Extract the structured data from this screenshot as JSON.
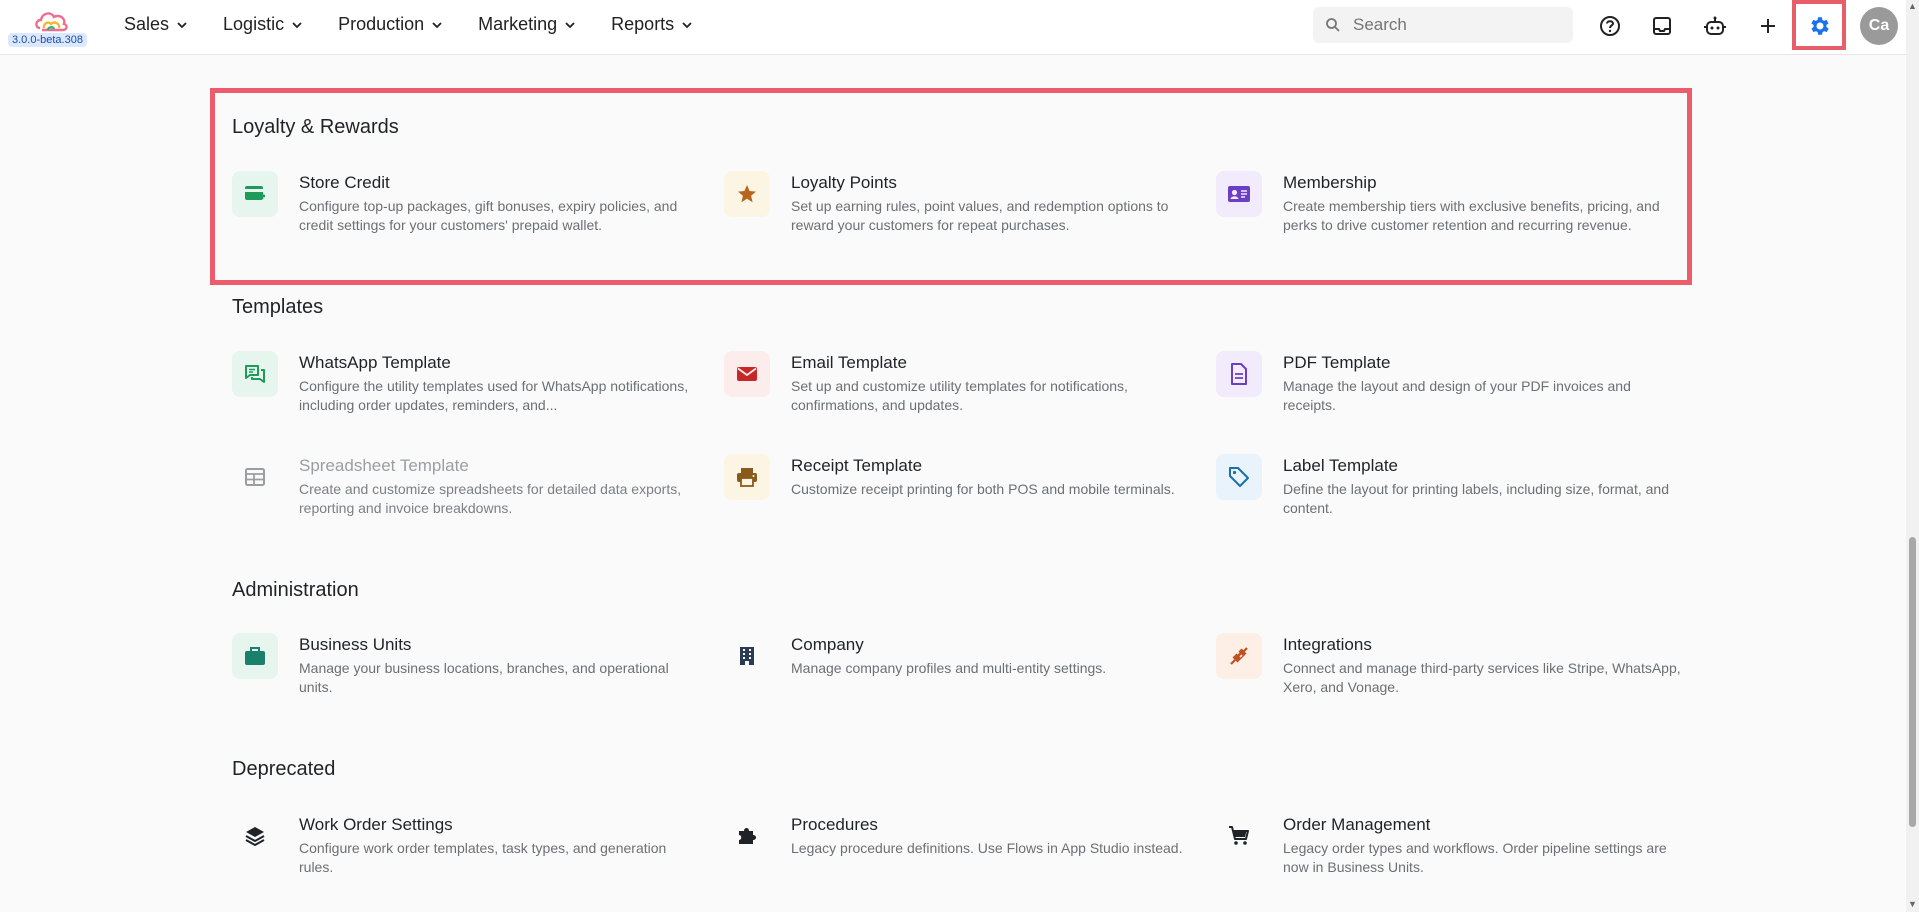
{
  "app": {
    "version": "3.0.0-beta.308"
  },
  "nav": [
    {
      "label": "Sales"
    },
    {
      "label": "Logistic"
    },
    {
      "label": "Production"
    },
    {
      "label": "Marketing"
    },
    {
      "label": "Reports"
    }
  ],
  "search": {
    "placeholder": "Search"
  },
  "user": {
    "initials": "Ca"
  },
  "sections": {
    "loyalty": {
      "title": "Loyalty & Rewards",
      "items": [
        {
          "title": "Store Credit",
          "desc": "Configure top-up packages, gift bonuses, expiry policies, and credit settings for your customers' prepaid wallet.",
          "icon": "store-credit-icon"
        },
        {
          "title": "Loyalty Points",
          "desc": "Set up earning rules, point values, and redemption options to reward your customers for repeat purchases.",
          "icon": "star-icon"
        },
        {
          "title": "Membership",
          "desc": "Create membership tiers with exclusive benefits, pricing, and perks to drive customer retention and recurring revenue.",
          "icon": "membership-card-icon"
        }
      ]
    },
    "templates": {
      "title": "Templates",
      "items": [
        {
          "title": "WhatsApp Template",
          "desc": "Configure the utility templates used for WhatsApp notifications, including order updates, reminders, and...",
          "icon": "chat-icon"
        },
        {
          "title": "Email Template",
          "desc": "Set up and customize utility templates for notifications, confirmations, and updates.",
          "icon": "mail-icon"
        },
        {
          "title": "PDF Template",
          "desc": "Manage the layout and design of your PDF invoices and receipts.",
          "icon": "document-icon"
        },
        {
          "title": "Spreadsheet Template",
          "desc": "Create and customize spreadsheets for detailed data exports, reporting and invoice breakdowns.",
          "icon": "table-icon"
        },
        {
          "title": "Receipt Template",
          "desc": "Customize receipt printing for both POS and mobile terminals.",
          "icon": "printer-icon"
        },
        {
          "title": "Label Template",
          "desc": "Define the layout for printing labels, including size, format, and content.",
          "icon": "tag-icon"
        }
      ]
    },
    "administration": {
      "title": "Administration",
      "items": [
        {
          "title": "Business Units",
          "desc": "Manage your business locations, branches, and operational units.",
          "icon": "briefcase-icon"
        },
        {
          "title": "Company",
          "desc": "Manage company profiles and multi-entity settings.",
          "icon": "building-icon"
        },
        {
          "title": "Integrations",
          "desc": "Connect and manage third-party services like Stripe, WhatsApp, Xero, and Vonage.",
          "icon": "plug-icon"
        }
      ]
    },
    "deprecated": {
      "title": "Deprecated",
      "items": [
        {
          "title": "Work Order Settings",
          "desc": "Configure work order templates, task types, and generation rules.",
          "icon": "layers-icon"
        },
        {
          "title": "Procedures",
          "desc": "Legacy procedure definitions. Use Flows in App Studio instead.",
          "icon": "puzzle-icon"
        },
        {
          "title": "Order Management",
          "desc": "Legacy order types and workflows. Order pipeline settings are now in Business Units.",
          "icon": "cart-icon"
        }
      ]
    }
  },
  "colors": {
    "highlight": "#ec5c6a",
    "gear_active": "#1a73e8"
  }
}
